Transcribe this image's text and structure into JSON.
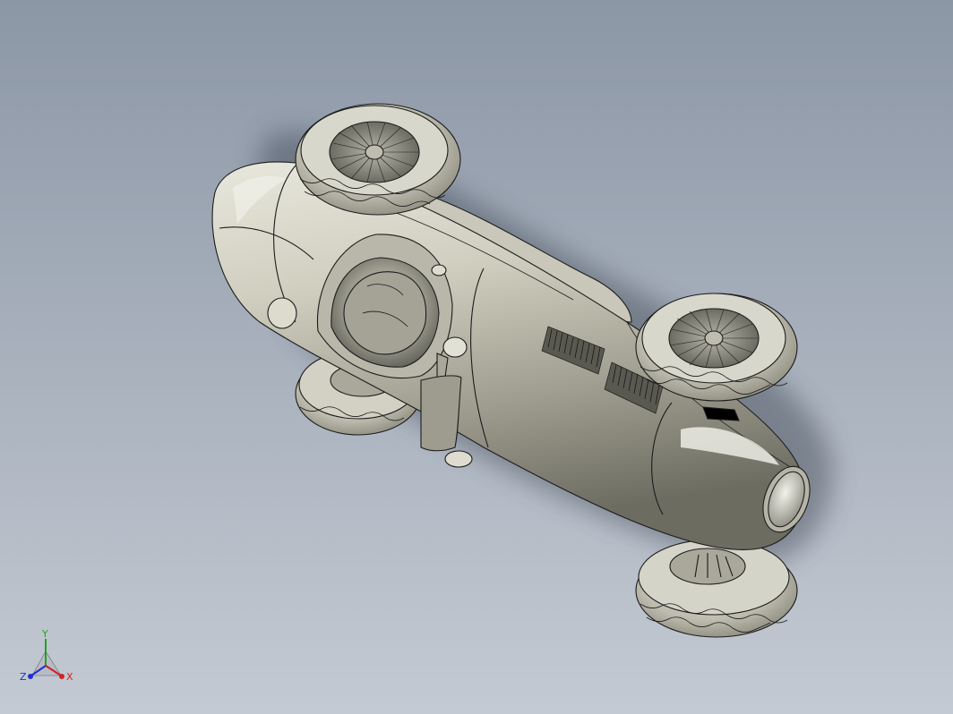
{
  "viewport": {
    "background_top": "#8c97a6",
    "background_bottom": "#c4cad3"
  },
  "model": {
    "body_color": "#c4c3b4",
    "body_shadow": "#6f6e62",
    "body_highlight": "#f4f4ec",
    "edge_color": "#1c1c1c",
    "tire_color": "#bdbcae",
    "interior_color": "#8f8e82"
  },
  "triad": {
    "x_label": "X",
    "y_label": "Y",
    "z_label": "Z",
    "x_color": "#d42020",
    "y_color": "#25a025",
    "z_color": "#2030d0"
  }
}
